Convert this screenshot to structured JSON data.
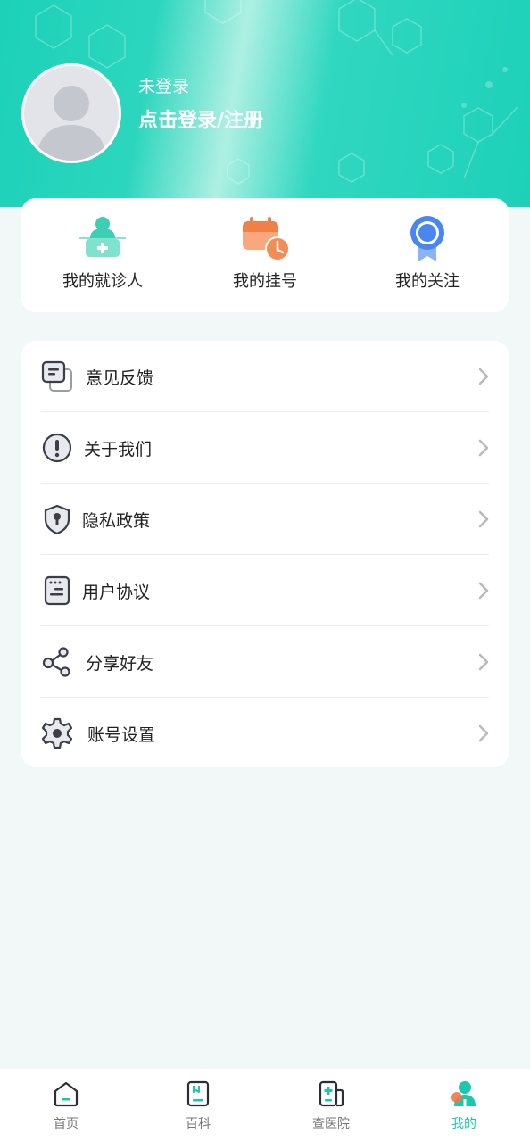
{
  "header": {
    "login_status": "未登录",
    "login_link": "点击登录/注册"
  },
  "quick_actions": [
    {
      "label": "我的就诊人",
      "icon": "patient-icon"
    },
    {
      "label": "我的挂号",
      "icon": "calendar-clock-icon"
    },
    {
      "label": "我的关注",
      "icon": "ribbon-badge-icon"
    }
  ],
  "menu": [
    {
      "label": "意见反馈",
      "icon": "feedback-icon"
    },
    {
      "label": "关于我们",
      "icon": "info-icon"
    },
    {
      "label": "隐私政策",
      "icon": "shield-icon"
    },
    {
      "label": "用户协议",
      "icon": "document-icon"
    },
    {
      "label": "分享好友",
      "icon": "share-icon"
    },
    {
      "label": "账号设置",
      "icon": "gear-icon"
    }
  ],
  "tabs": [
    {
      "label": "首页",
      "icon": "home-icon",
      "active": false
    },
    {
      "label": "百科",
      "icon": "book-icon",
      "active": false
    },
    {
      "label": "查医院",
      "icon": "hospital-icon",
      "active": false
    },
    {
      "label": "我的",
      "icon": "profile-icon",
      "active": true
    }
  ],
  "colors": {
    "accent": "#1ac8ad",
    "header_bg": "#1cd1b8",
    "page_bg": "#f1f8f7",
    "registration_orange": "#f58c56",
    "follow_blue": "#4a86f0"
  }
}
